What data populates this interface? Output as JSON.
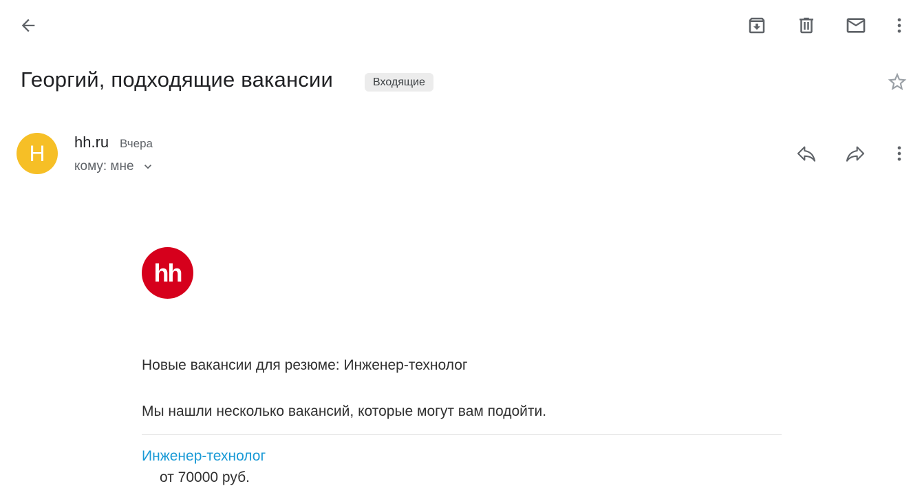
{
  "toolbar": {
    "back_icon": "arrow-back-icon",
    "archive_icon": "archive-icon",
    "delete_icon": "trash-icon",
    "mark_unread_icon": "mail-icon",
    "more_icon": "more-vert-icon"
  },
  "message": {
    "subject": "Георгий, подходящие вакансии",
    "label": "Входящие",
    "starred": false
  },
  "sender": {
    "avatar_letter": "H",
    "avatar_color": "#F6BF26",
    "name": "hh.ru",
    "time": "Вчера",
    "recipient": "кому: мне"
  },
  "email_body": {
    "logo_text": "hh",
    "logo_color": "#D6001C",
    "heading": "Новые вакансии для резюме: Инженер-технолог",
    "intro": "Мы нашли несколько вакансий, которые могут вам подойти.",
    "vacancy_title": "Инженер-технолог",
    "vacancy_salary": "от 70000 руб."
  },
  "colors": {
    "link": "#1a9ad6",
    "icon": "#5f6368",
    "chip_bg": "#ececec"
  }
}
